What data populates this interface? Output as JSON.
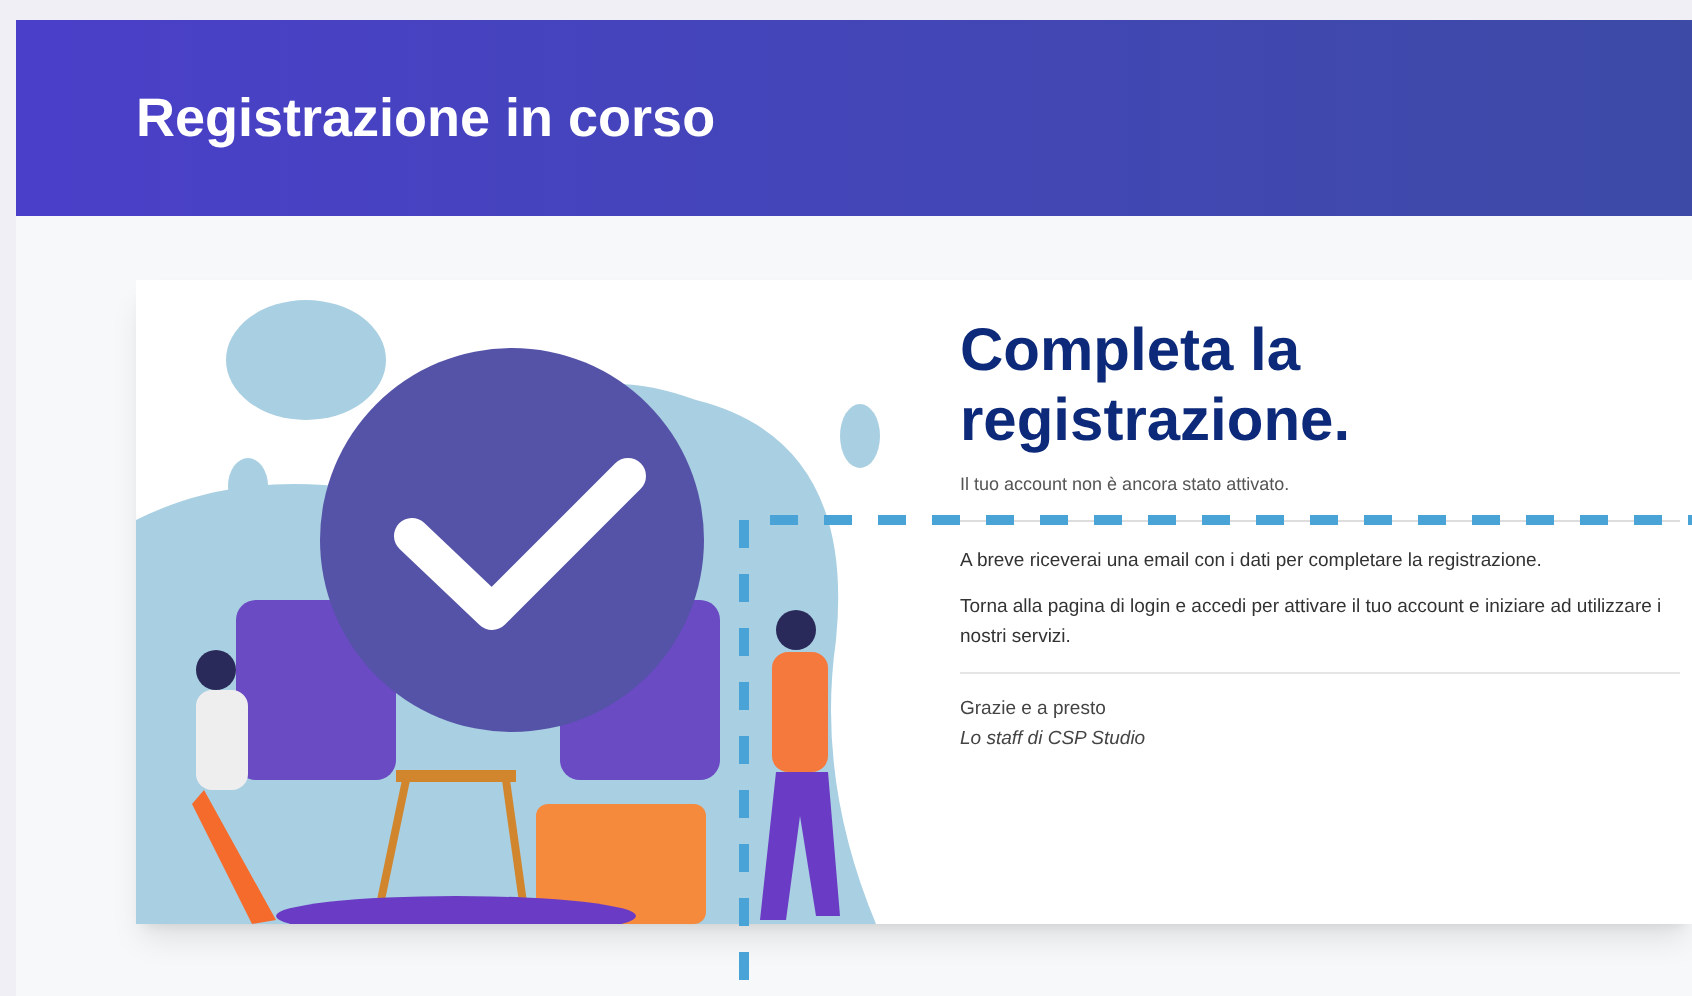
{
  "header": {
    "title": "Registrazione in corso"
  },
  "card": {
    "heading": "Completa la registrazione.",
    "subtitle": "Il tuo account non è ancora stato attivato.",
    "paragraphs": [
      "A breve riceverai una email con i dati per completare la registrazione.",
      "Torna alla pagina di login e accedi per attivare il tuo account e iniziare ad utilizzare i nostri servizi."
    ],
    "closing": "Grazie e a presto",
    "signature": "Lo staff di CSP Studio"
  }
}
